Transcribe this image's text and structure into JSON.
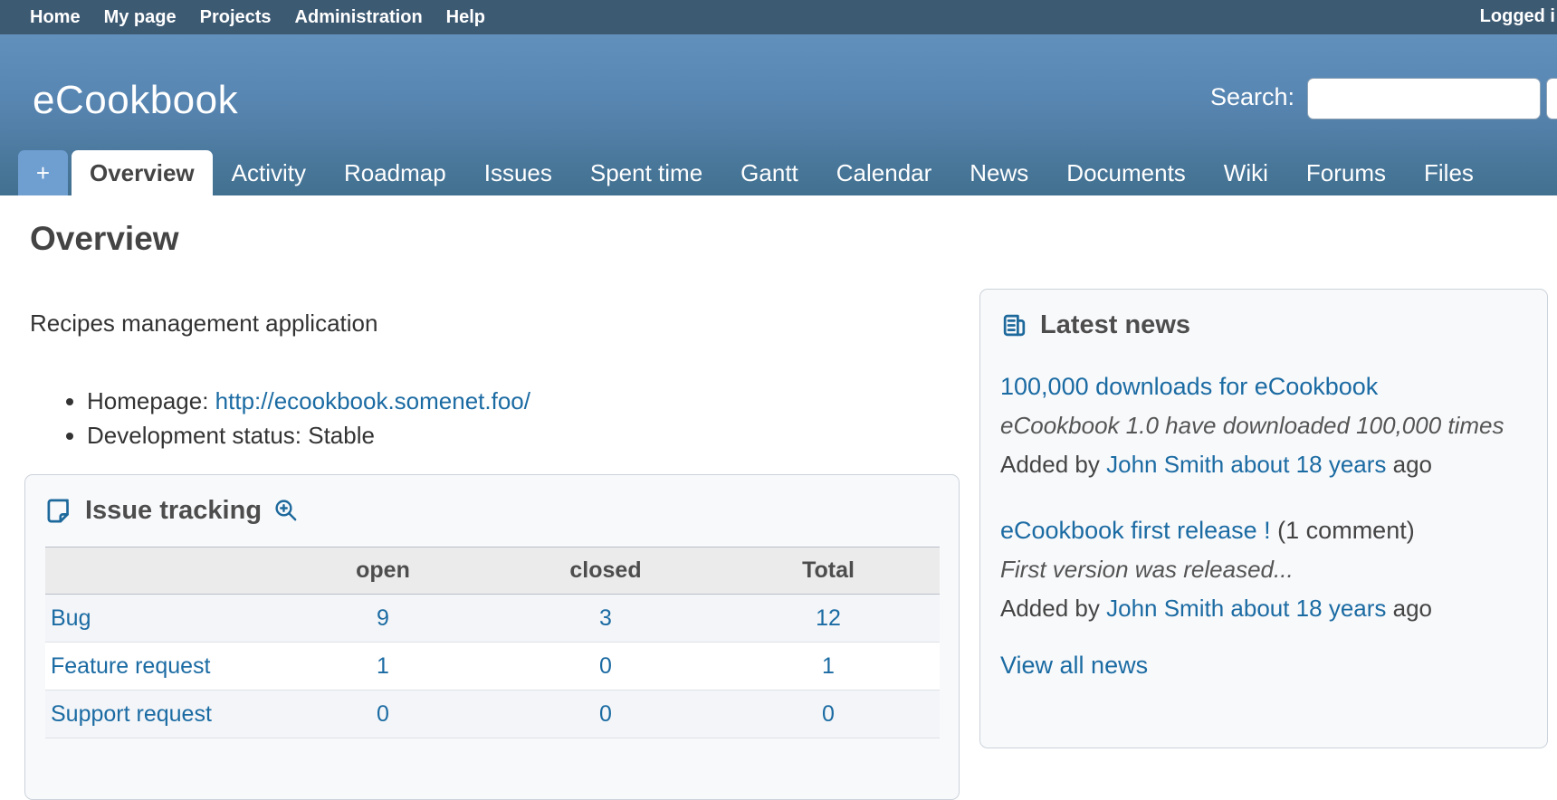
{
  "topbar": {
    "items": [
      "Home",
      "My page",
      "Projects",
      "Administration",
      "Help"
    ],
    "logged_in_text": "Logged i"
  },
  "header": {
    "app_title": "eCookbook",
    "search_label": "Search:",
    "search_value": ""
  },
  "tabs": {
    "add_label": "+",
    "items": [
      {
        "label": "Overview",
        "active": true
      },
      {
        "label": "Activity"
      },
      {
        "label": "Roadmap"
      },
      {
        "label": "Issues"
      },
      {
        "label": "Spent time"
      },
      {
        "label": "Gantt"
      },
      {
        "label": "Calendar"
      },
      {
        "label": "News"
      },
      {
        "label": "Documents"
      },
      {
        "label": "Wiki"
      },
      {
        "label": "Forums"
      },
      {
        "label": "Files"
      }
    ]
  },
  "page": {
    "title": "Overview",
    "description": "Recipes management application",
    "bullets": {
      "homepage_label": "Homepage:",
      "homepage_link": "http://ecookbook.somenet.foo/",
      "dev_status": "Development status: Stable"
    }
  },
  "issue_tracking": {
    "title": "Issue tracking",
    "columns": {
      "tracker": "",
      "open": "open",
      "closed": "closed",
      "total": "Total"
    },
    "rows": [
      {
        "tracker": "Bug",
        "open": "9",
        "closed": "3",
        "total": "12"
      },
      {
        "tracker": "Feature request",
        "open": "1",
        "closed": "0",
        "total": "1"
      },
      {
        "tracker": "Support request",
        "open": "0",
        "closed": "0",
        "total": "0"
      }
    ]
  },
  "news": {
    "title": "Latest news",
    "items": [
      {
        "title_link": "100,000 downloads for eCookbook",
        "comment_suffix": "",
        "summary": "eCookbook 1.0 have downloaded 100,000 times",
        "added_prefix": "Added by",
        "author_time_link": "John Smith about 18 years",
        "added_suffix": "ago"
      },
      {
        "title_link": "eCookbook first release !",
        "comment_suffix": "(1 comment)",
        "summary": "First version was released...",
        "added_prefix": "Added by",
        "author_time_link": "John Smith about 18 years",
        "added_suffix": "ago"
      }
    ],
    "view_all": "View all news"
  },
  "colors": {
    "topbar_bg": "#3d5a73",
    "header_gradient_top": "#6290bd",
    "header_gradient_bottom": "#42708f",
    "add_tab_bg": "#6f9fd1",
    "link_blue": "#1b6ba3",
    "box_bg": "#f8f9fb",
    "box_border": "#ccd3da",
    "table_header_bg": "#ebebec"
  }
}
